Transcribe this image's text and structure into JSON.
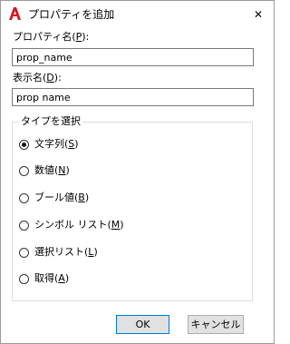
{
  "dialog": {
    "title": "プロパティを追加",
    "close_glyph": "✕"
  },
  "property_name": {
    "label": "プロパティ名",
    "mnemonic": "P",
    "value": "prop_name"
  },
  "display_name": {
    "label": "表示名",
    "mnemonic": "D",
    "value": "prop name"
  },
  "type_group": {
    "title": "タイプを選択",
    "options": [
      {
        "label": "文字列",
        "mnemonic": "S",
        "checked": true
      },
      {
        "label": "数値",
        "mnemonic": "N",
        "checked": false
      },
      {
        "label": "ブール値",
        "mnemonic": "B",
        "checked": false
      },
      {
        "label": "シンボル リスト",
        "mnemonic": "M",
        "checked": false
      },
      {
        "label": "選択リスト",
        "mnemonic": "L",
        "checked": false
      },
      {
        "label": "取得",
        "mnemonic": "A",
        "checked": false
      }
    ]
  },
  "buttons": {
    "ok": "OK",
    "cancel": "キャンセル"
  },
  "colors": {
    "app_icon": "#d71920",
    "default_button_border": "#0078d7",
    "button_face": "#e1e1e1"
  }
}
